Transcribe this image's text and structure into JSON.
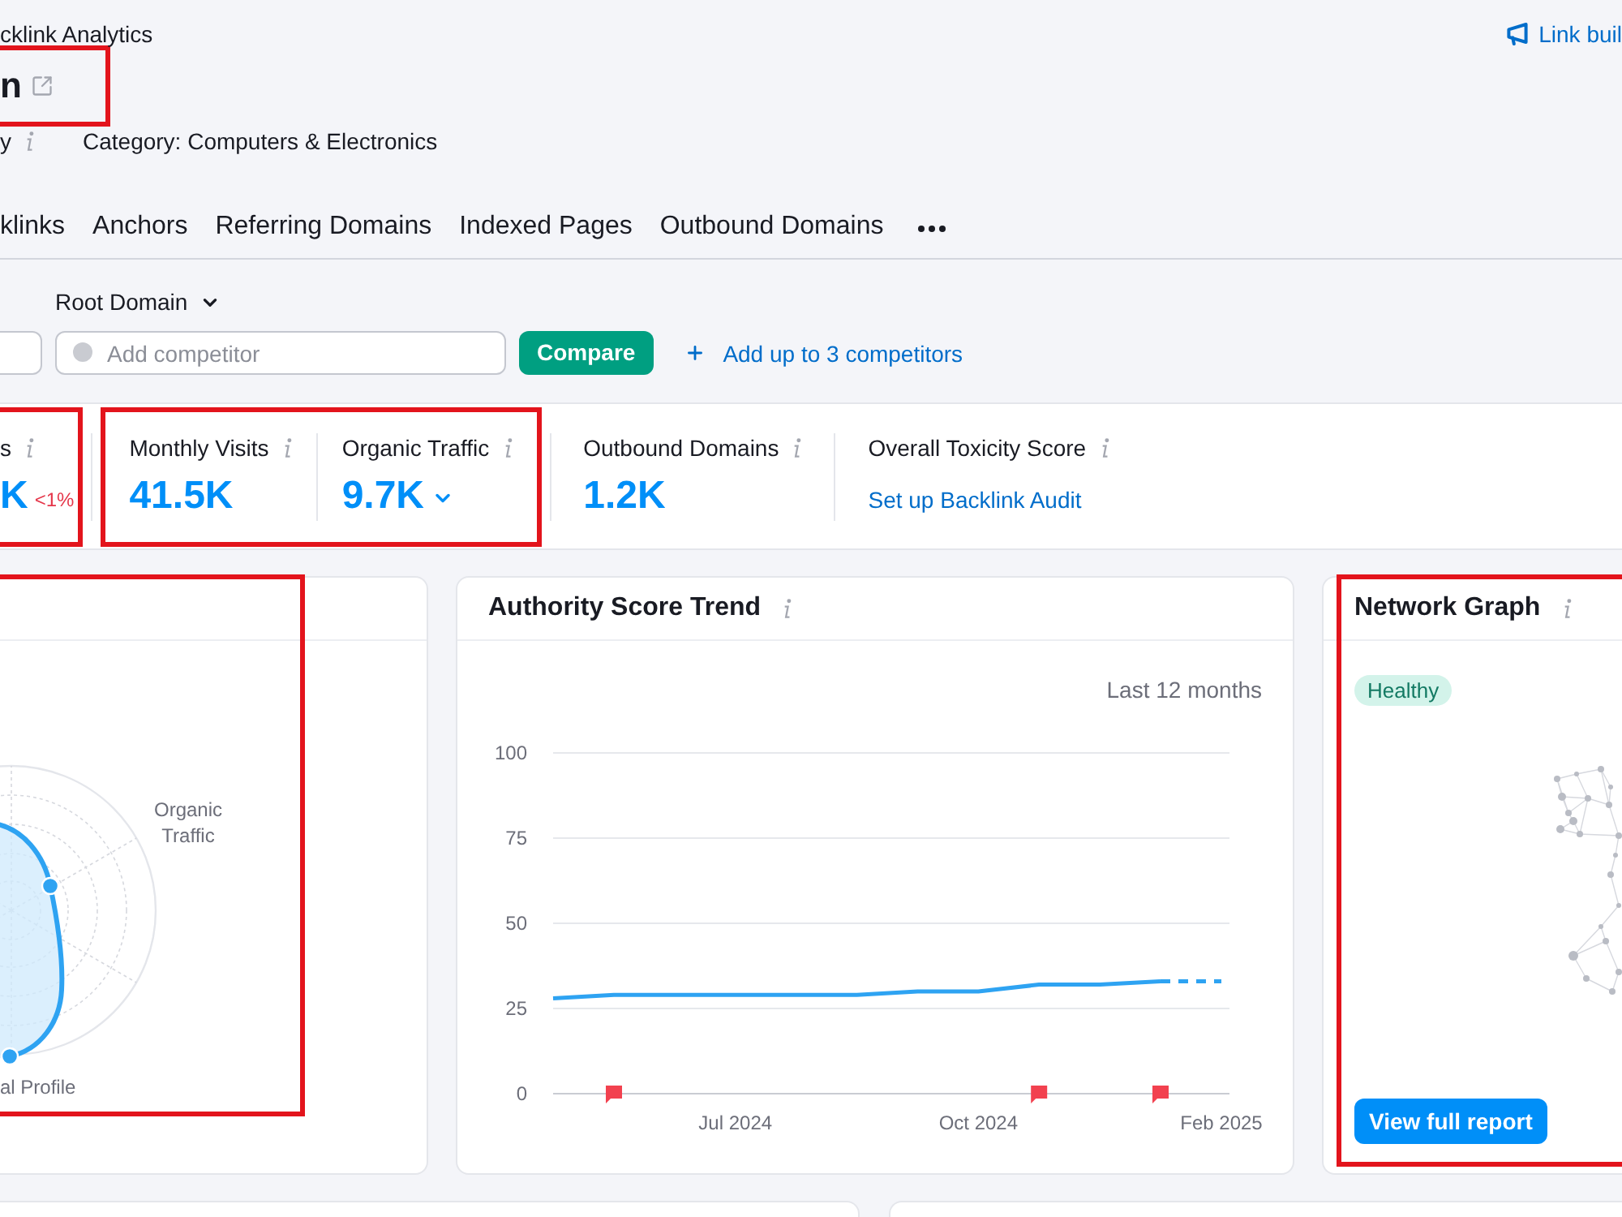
{
  "header": {
    "breadcrumb": "cklink Analytics",
    "link": "Link buil",
    "title": "n",
    "title_highlighted": true,
    "meta": [
      {
        "text": "y",
        "info": true
      },
      {
        "text": "Category: Computers & Electronics",
        "info": false
      }
    ]
  },
  "tabs": [
    {
      "label": "klinks",
      "selected": false
    },
    {
      "label": "Anchors",
      "selected": false
    },
    {
      "label": "Referring Domains",
      "selected": false
    },
    {
      "label": "Indexed Pages",
      "selected": false
    },
    {
      "label": "Outbound Domains",
      "selected": false
    }
  ],
  "filters": {
    "scope": "Root Domain",
    "competitor_placeholder": "Add competitor",
    "compare_button": "Compare",
    "add_link": "Add up to 3 competitors"
  },
  "metric_groups": [
    {
      "highlighted": true,
      "metrics": [
        {
          "kind": "value",
          "label": "s",
          "value": "K",
          "change": "<1%",
          "dropdown": false
        }
      ]
    },
    {
      "highlighted": true,
      "metrics": [
        {
          "kind": "value",
          "label": "Monthly Visits",
          "value": "41.5K",
          "dropdown": false
        },
        {
          "kind": "value",
          "label": "Organic Traffic",
          "value": "9.7K",
          "dropdown": true
        }
      ]
    },
    {
      "highlighted": false,
      "metrics": [
        {
          "kind": "value",
          "label": "Outbound Domains",
          "value": "1.2K",
          "dropdown": false
        }
      ]
    },
    {
      "highlighted": false,
      "metrics": [
        {
          "kind": "link",
          "label": "Overall Toxicity Score",
          "link": "Set up Backlink Audit"
        }
      ]
    }
  ],
  "radar_card": {
    "highlighted": true,
    "axis_labels": [
      "Organic Traffic",
      "al Profile"
    ]
  },
  "trend_card": {
    "title": "Authority Score Trend",
    "period": "Last 12 months",
    "chart_data": {
      "type": "line",
      "categories": [
        null,
        null,
        null,
        "Jul 2024",
        null,
        null,
        null,
        "Oct 2024",
        null,
        null,
        null,
        "Feb 2025"
      ],
      "ylim": [
        0,
        100
      ],
      "yticks": [
        0,
        25,
        50,
        75,
        100
      ],
      "grid": true,
      "series": [
        {
          "color": "#2ea3f2",
          "values": [
            28,
            29,
            29,
            29,
            29,
            29,
            30,
            30,
            32,
            32,
            33,
            null
          ]
        },
        {
          "color": "#2ea3f2",
          "line_style": "dashed",
          "values": [
            null,
            null,
            null,
            null,
            null,
            null,
            null,
            null,
            null,
            null,
            33,
            33
          ]
        },
        {
          "type": "scatter",
          "marker": "square",
          "color": "#f2414f",
          "values": [
            null,
            0,
            null,
            null,
            null,
            null,
            null,
            null,
            0,
            null,
            0,
            null
          ]
        }
      ]
    }
  },
  "network_card": {
    "title": "Network Graph",
    "status": "Healthy",
    "button": "View full report",
    "highlighted": true
  }
}
